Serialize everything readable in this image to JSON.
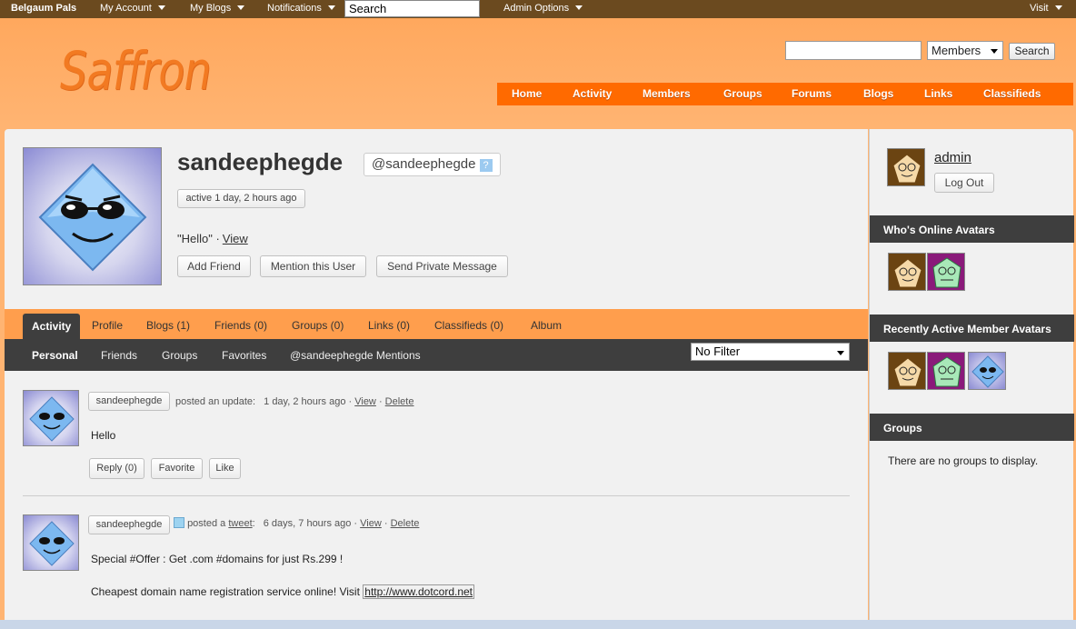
{
  "adminbar": {
    "site_name": "Belgaum Pals",
    "my_account": "My Account",
    "my_blogs": "My Blogs",
    "notifications": "Notifications",
    "search_value": "Search",
    "admin_options": "Admin Options",
    "visit": "Visit"
  },
  "header": {
    "logo": "Saffron",
    "search_scope": "Members",
    "search_button": "Search"
  },
  "nav": [
    "Home",
    "Activity",
    "Members",
    "Groups",
    "Forums",
    "Blogs",
    "Links",
    "Classifieds"
  ],
  "profile": {
    "name": "sandeephegde",
    "handle": "@sandeephegde",
    "help_glyph": "?",
    "active": "active 1 day, 2 hours ago",
    "status_text": "\"Hello\" ·",
    "status_link": "View",
    "buttons": {
      "add_friend": "Add Friend",
      "mention": "Mention this User",
      "message": "Send Private Message"
    }
  },
  "tabs": [
    "Activity",
    "Profile",
    "Blogs (1)",
    "Friends (0)",
    "Groups (0)",
    "Links (0)",
    "Classifieds (0)",
    "Album"
  ],
  "subnav": [
    "Personal",
    "Friends",
    "Groups",
    "Favorites",
    "@sandeephegde Mentions"
  ],
  "filter": "No Filter",
  "activity": [
    {
      "user": "sandeephegde",
      "action": "posted an update:",
      "time": "1 day, 2 hours ago ·",
      "view": "View",
      "delete": "Delete",
      "text": "Hello",
      "reply": "Reply (0)",
      "favorite": "Favorite",
      "like": "Like"
    },
    {
      "user": "sandeephegde",
      "action": "posted a",
      "action_link": "tweet",
      "time": "6 days, 7 hours ago ·",
      "view": "View",
      "delete": "Delete",
      "text1": "Special #Offer : Get .com #domains for just Rs.299 !",
      "text2": "Cheapest domain name registration service online! Visit",
      "link": "http://www.dotcord.net"
    }
  ],
  "sidebar": {
    "admin_name": "admin",
    "logout": "Log Out",
    "online_title": "Who's Online Avatars",
    "recent_title": "Recently Active Member Avatars",
    "groups_title": "Groups",
    "groups_empty": "There are no groups to display."
  },
  "colors": {
    "orange_nav": "#ff6a00",
    "dark_bar": "#3e3e3e",
    "admin_bar": "#6b4a1f"
  }
}
